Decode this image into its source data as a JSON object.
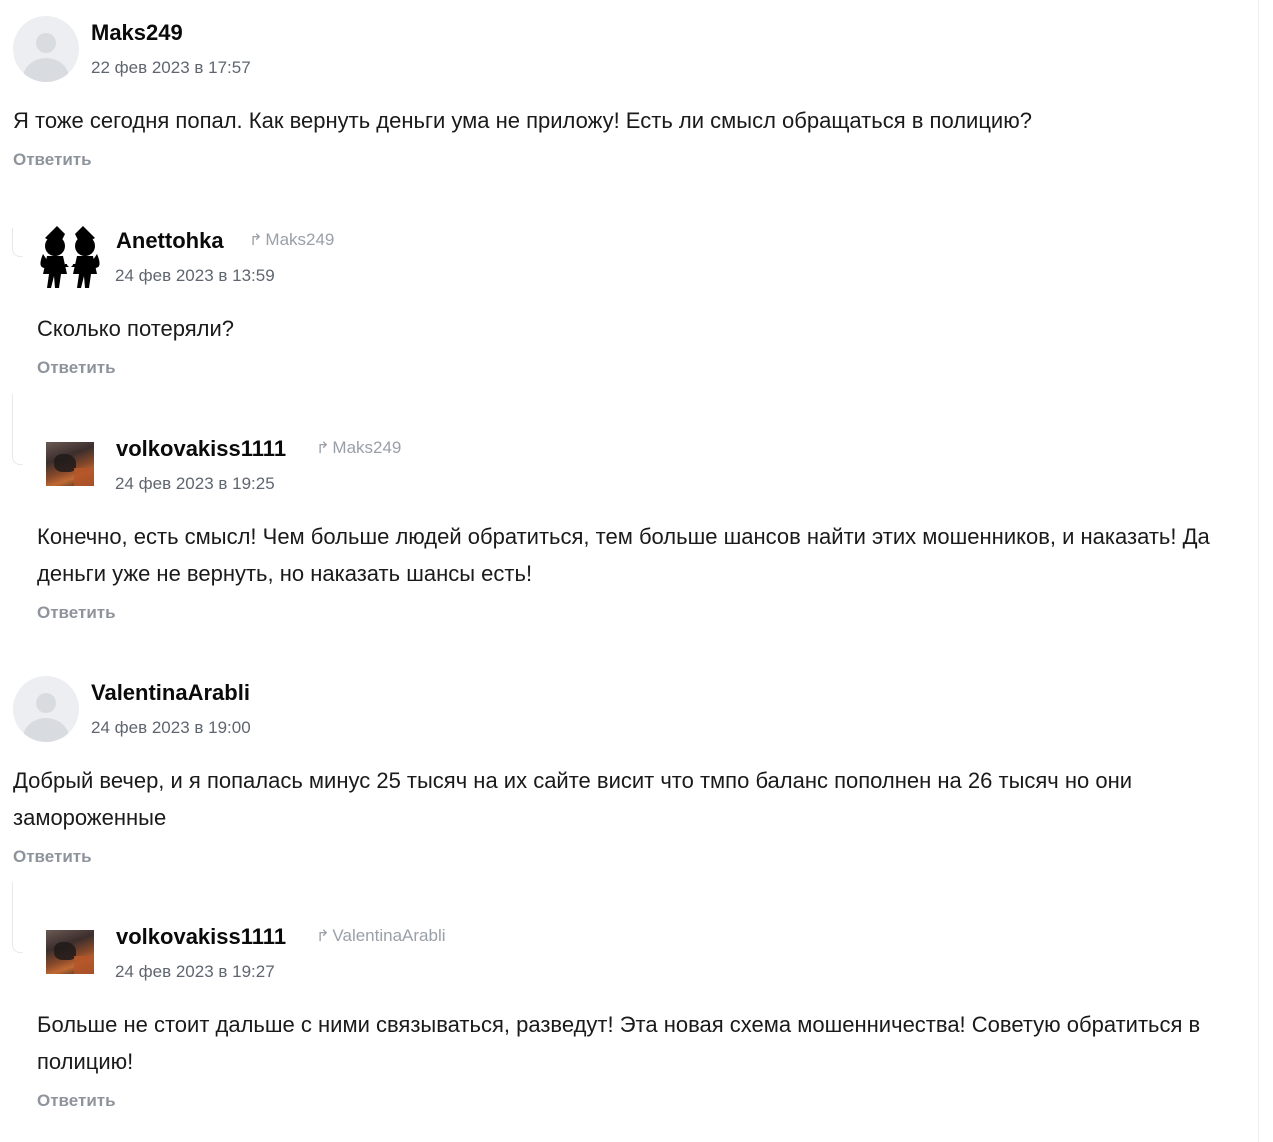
{
  "answer_label": "Ответить",
  "comments": [
    {
      "author": "Maks249",
      "date": "22 фев 2023 в 17:57",
      "text": "Я тоже сегодня попал. Как вернуть деньги ума не приложу! Есть ли смысл обращаться в полицию?",
      "avatar": "default-avatar-icon"
    },
    {
      "author": "Anettohka",
      "reply_to": "Maks249",
      "date": "24 фев 2023 в 13:59",
      "text": "Сколько потеряли?",
      "avatar": "silhouette-couple-avatar"
    },
    {
      "author": "volkovakiss1111",
      "reply_to": "Maks249",
      "date": "24 фев 2023 в 19:25",
      "text": "Конечно, есть смысл! Чем больше людей обратиться, тем больше шансов найти этих мошенников, и наказать! Да деньги уже не вернуть, но наказать шансы есть!",
      "avatar": "photo-avatar"
    },
    {
      "author": "ValentinaArabli",
      "date": "24 фев 2023 в 19:00",
      "text": "Добрый вечер, и я попалась минус 25 тысяч на их сайте висит что тмпо баланс пополнен на 26 тысяч но они замороженные",
      "avatar": "default-avatar-icon"
    },
    {
      "author": "volkovakiss1111",
      "reply_to": "ValentinaArabli",
      "date": "24 фев 2023 в 19:27",
      "text": "Больше не стоит дальше с ними связываться, разведут! Эта новая схема мошенничества! Советую обратиться в полицию!",
      "avatar": "photo-avatar"
    }
  ],
  "colors": {
    "nick": "#0a0a0a",
    "date": "#5f6670",
    "answer": "#8e949c",
    "reply_to": "#9aa0a8"
  }
}
